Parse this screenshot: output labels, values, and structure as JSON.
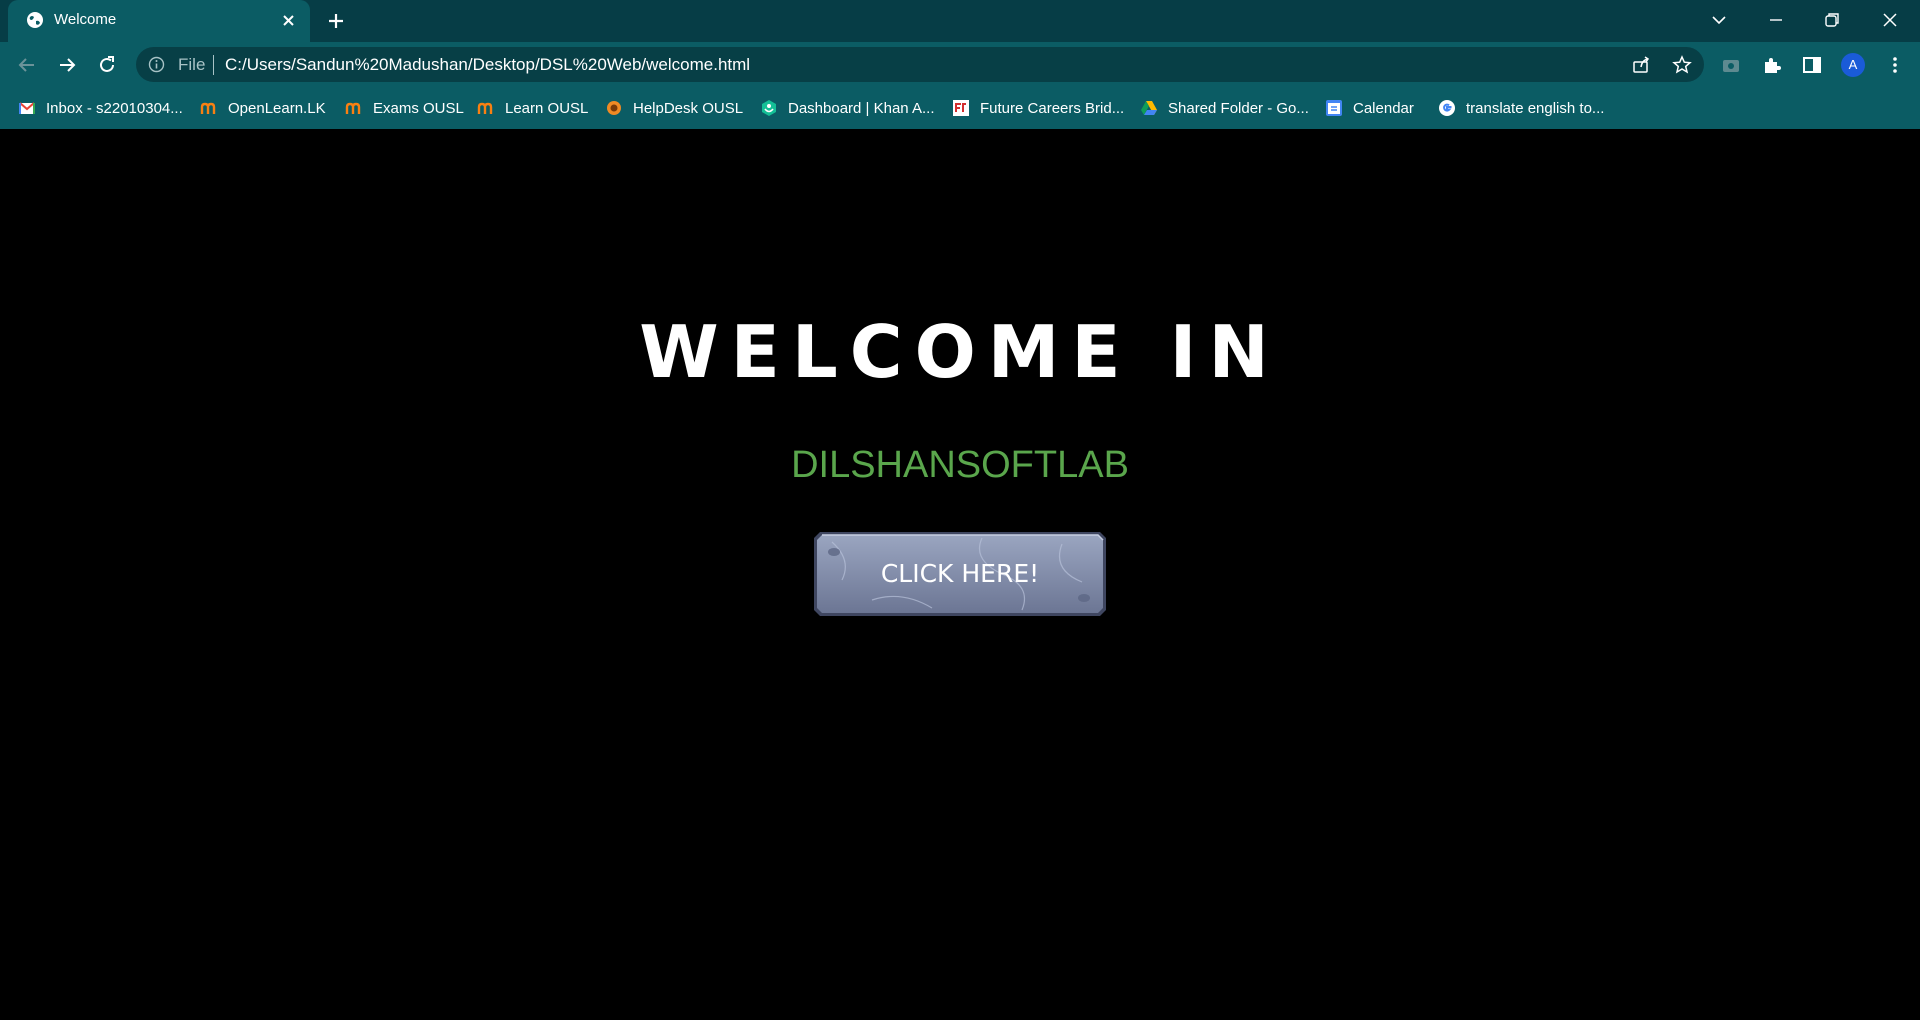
{
  "tab": {
    "title": "Welcome",
    "favicon": "globe-icon"
  },
  "toolbar": {
    "omnibox": {
      "scheme_label": "File",
      "url": "C:/Users/Sandun%20Madushan/Desktop/DSL%20Web/welcome.html"
    },
    "profile_initial": "A"
  },
  "bookmarks": [
    {
      "label": "Inbox - s22010304...",
      "icon": "gmail-icon"
    },
    {
      "label": "OpenLearn.LK",
      "icon": "moodle-icon"
    },
    {
      "label": "Exams OUSL",
      "icon": "moodle-icon"
    },
    {
      "label": "Learn OUSL",
      "icon": "moodle-icon"
    },
    {
      "label": "HelpDesk OUSL",
      "icon": "helpdesk-icon"
    },
    {
      "label": "Dashboard | Khan A...",
      "icon": "khan-academy-icon"
    },
    {
      "label": "Future Careers Brid...",
      "icon": "future-careers-icon"
    },
    {
      "label": "Shared Folder - Go...",
      "icon": "google-drive-icon"
    },
    {
      "label": "Calendar",
      "icon": "google-calendar-icon"
    },
    {
      "label": "translate english to...",
      "icon": "google-icon"
    }
  ],
  "page": {
    "title": "WELCOME IN",
    "brand": "DILSHANSOFTLAB",
    "cta_label": "CLICK HERE!"
  },
  "colors": {
    "tabstrip": "#063d46",
    "toolbar": "#0b5c64",
    "omnibox": "#073f46",
    "page_background": "#000000",
    "brand_green": "#5aa64c",
    "button_stone": "#7b86a4"
  }
}
